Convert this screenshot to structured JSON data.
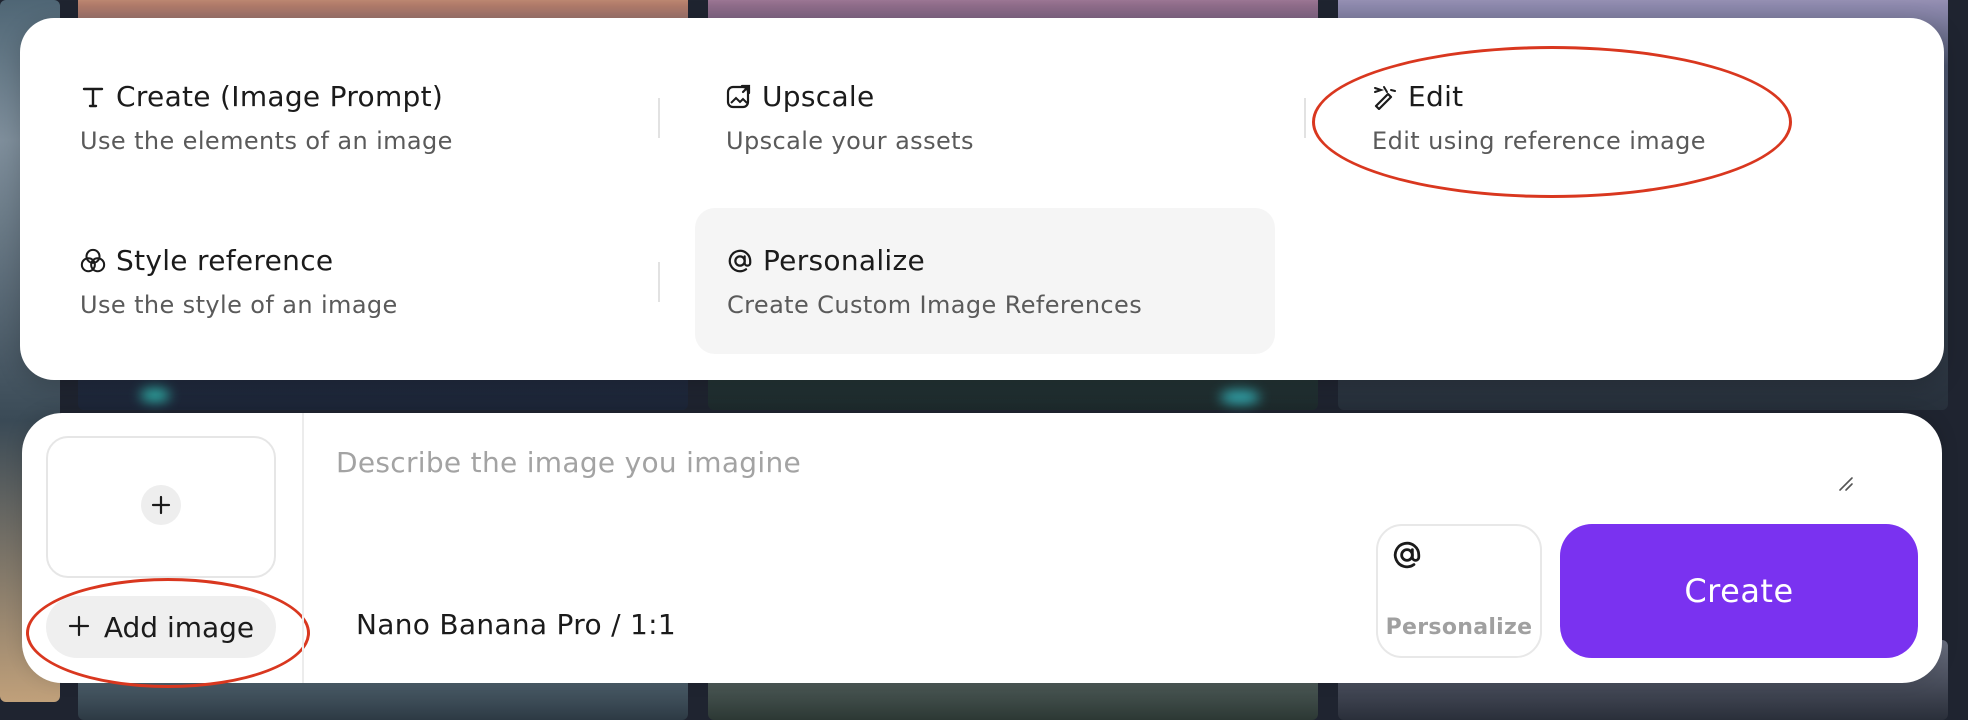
{
  "menu": {
    "options": [
      {
        "key": "create",
        "icon": "text-t-icon",
        "title": "Create (Image Prompt)",
        "description": "Use the elements of an image"
      },
      {
        "key": "upscale",
        "icon": "upscale-icon",
        "title": "Upscale",
        "description": "Upscale your assets"
      },
      {
        "key": "edit",
        "icon": "edit-wand-icon",
        "title": "Edit",
        "description": "Edit using reference image"
      },
      {
        "key": "style",
        "icon": "style-circles-icon",
        "title": "Style reference",
        "description": "Use the style of an image"
      },
      {
        "key": "personalize",
        "icon": "at-icon",
        "title": "Personalize",
        "description": "Create Custom Image References"
      }
    ]
  },
  "prompt_bar": {
    "placeholder": "Describe the image you imagine",
    "add_image_label": "Add image",
    "model_label": "Nano Banana Pro / 1:1",
    "personalize_label": "Personalize",
    "create_label": "Create"
  },
  "colors": {
    "accent": "#7a32f0",
    "annotation": "#d9371f",
    "background": "#ffffff"
  }
}
